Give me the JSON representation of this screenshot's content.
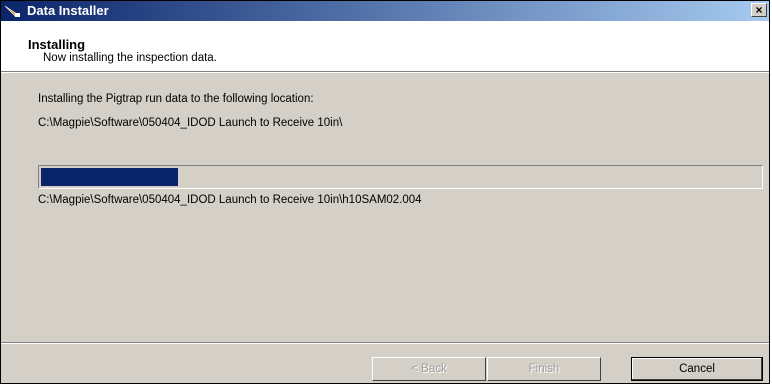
{
  "window": {
    "title": "Data Installer",
    "close_label": "×"
  },
  "header": {
    "title": "Installing",
    "subtitle": "Now installing the inspection data."
  },
  "main": {
    "intro_text": "Installing the Pigtrap run data to the following location:",
    "install_path": "C:\\Magpie\\Software\\050404_IDOD Launch to Receive 10in\\",
    "progress_fraction": 0.19,
    "current_file": "C:\\Magpie\\Software\\050404_IDOD Launch to Receive 10in\\h10SAM02.004"
  },
  "buttons": {
    "back_label": "< Back",
    "finish_label": "Finish",
    "cancel_label": "Cancel"
  },
  "colors": {
    "progress_fill": "#0a246a",
    "title_bar_start": "#0a246a",
    "dialog_face": "#d4d0c8"
  },
  "icons": {
    "app_icon": "installer-icon",
    "close_icon": "close-icon"
  }
}
